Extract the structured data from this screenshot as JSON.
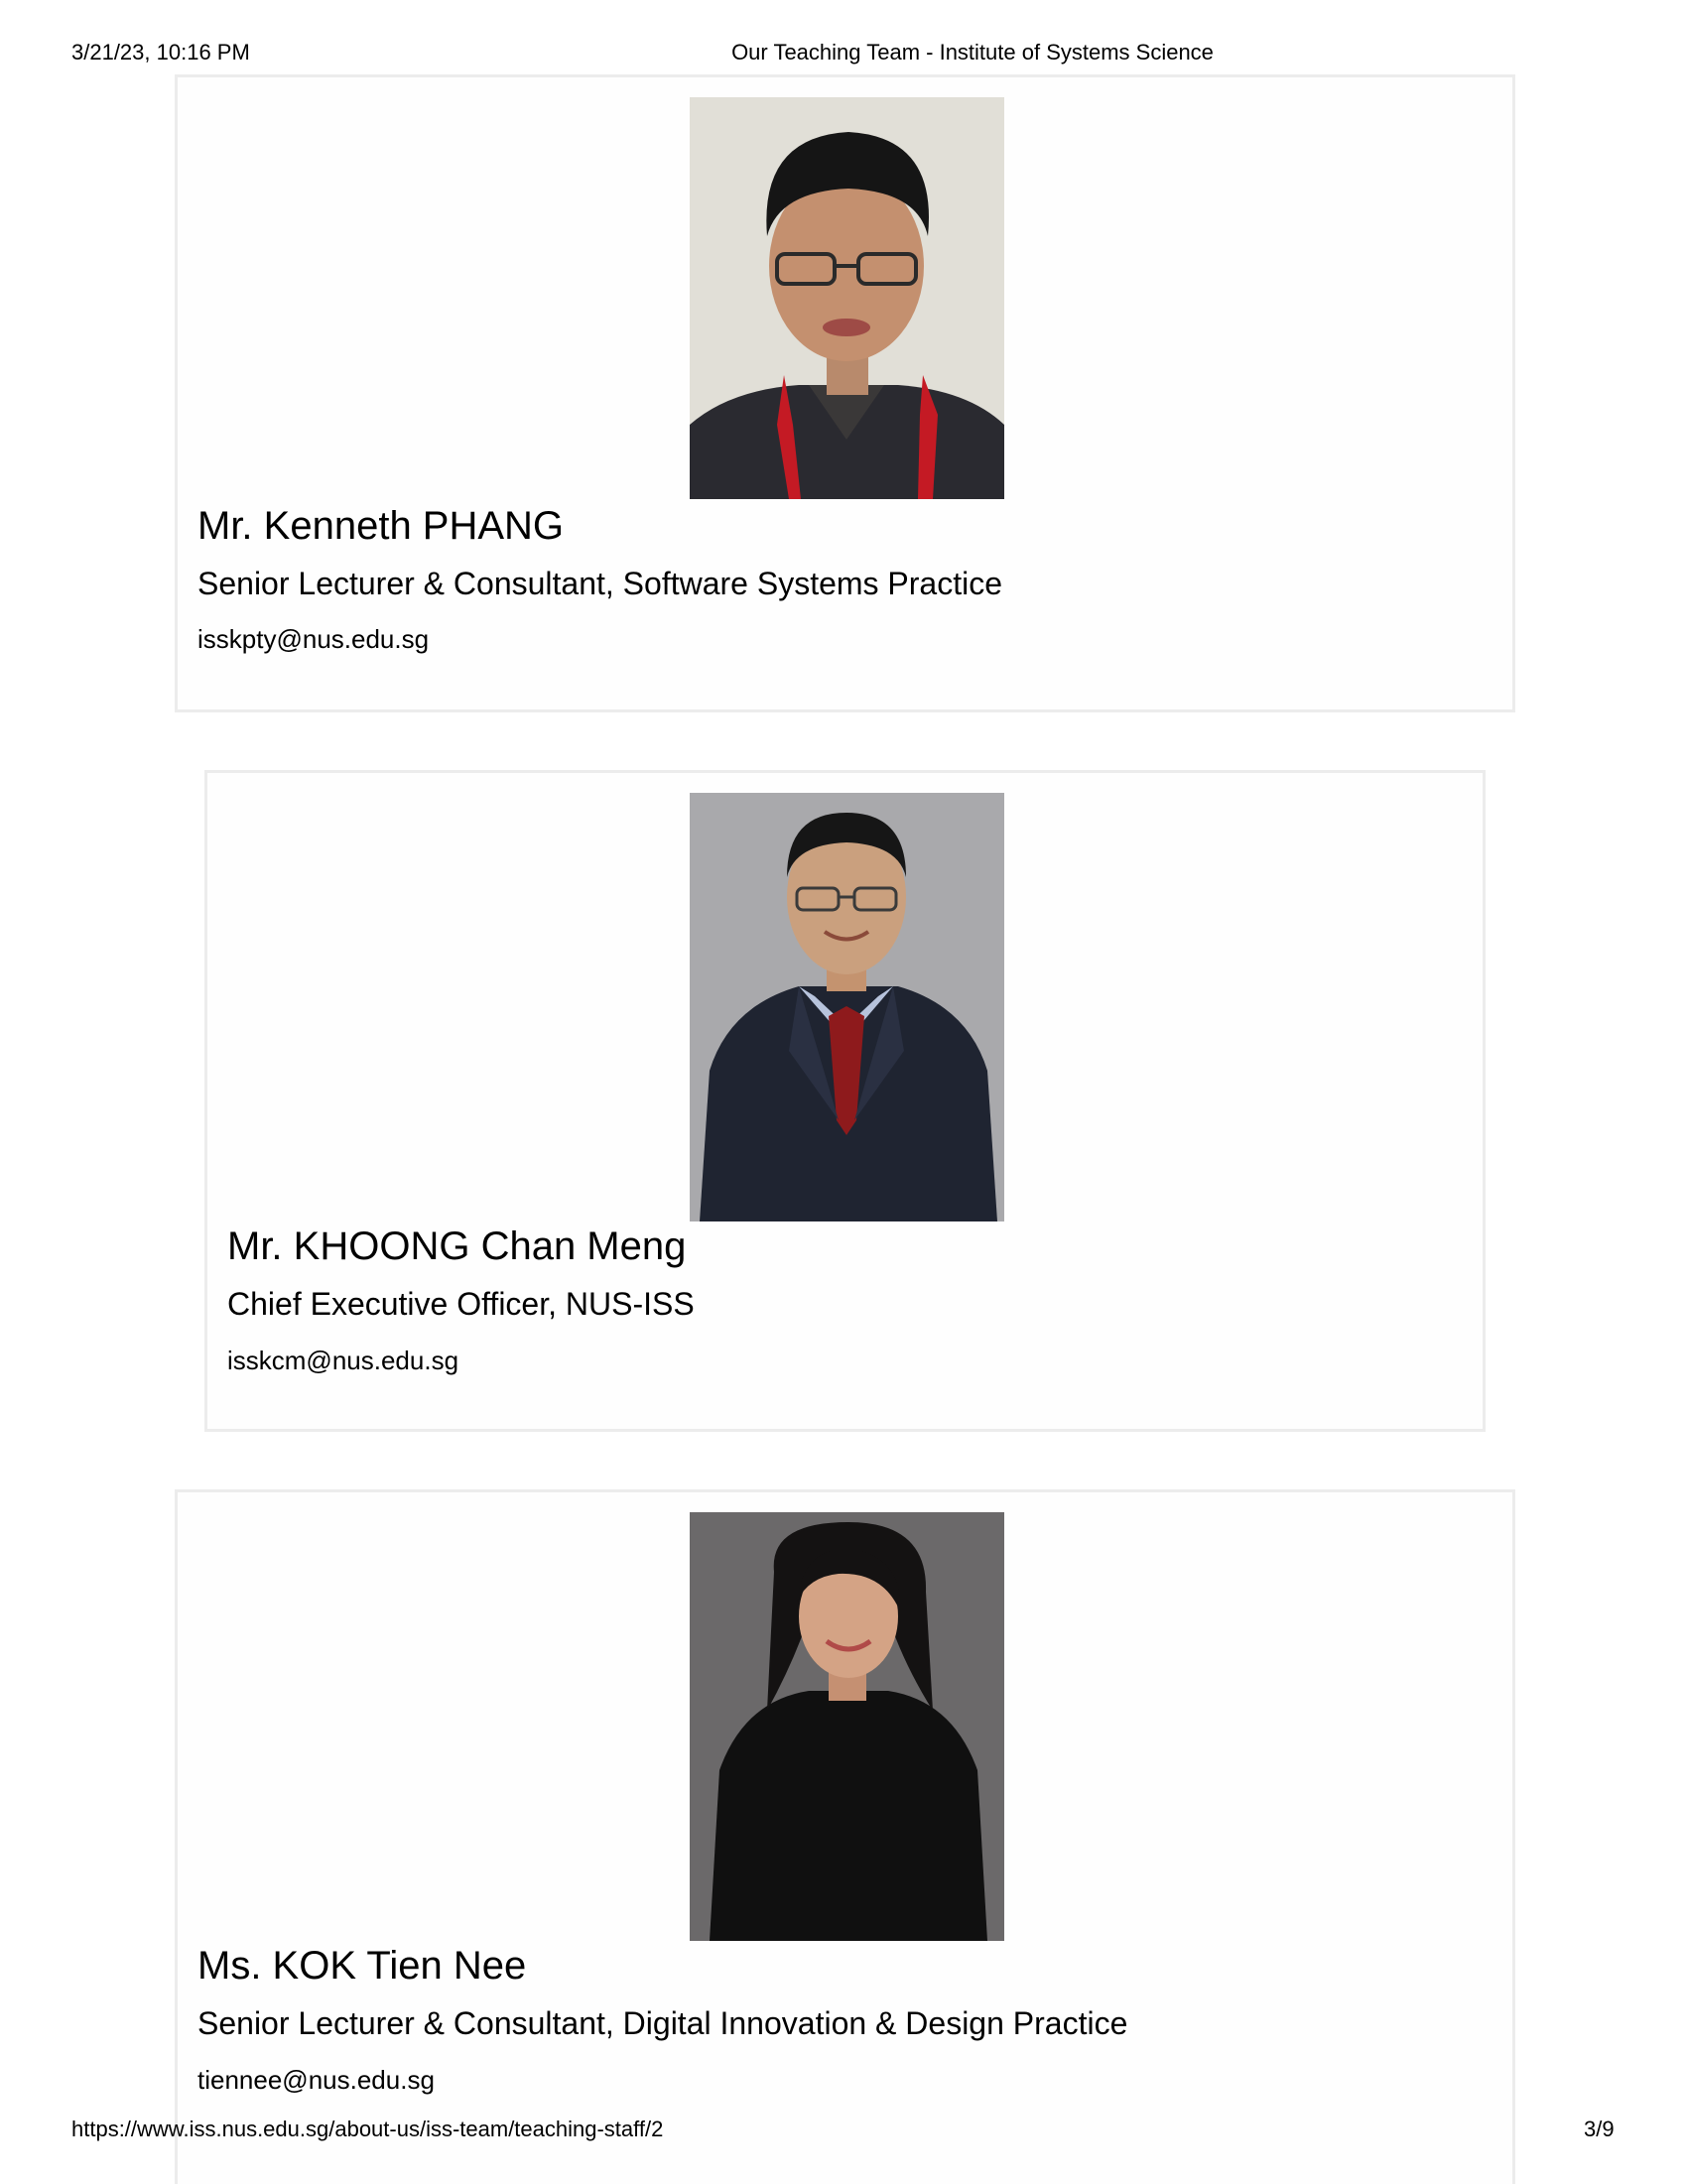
{
  "header": {
    "datetime": "3/21/23, 10:16 PM",
    "title": "Our Teaching Team - Institute of Systems Science"
  },
  "staff": [
    {
      "name": "Mr. Kenneth PHANG",
      "role": "Senior Lecturer & Consultant, Software Systems Practice",
      "email": "isskpty@nus.edu.sg"
    },
    {
      "name": "Mr. KHOONG Chan Meng",
      "role": "Chief Executive Officer, NUS-ISS",
      "email": "isskcm@nus.edu.sg"
    },
    {
      "name": "Ms. KOK Tien Nee",
      "role": "Senior Lecturer & Consultant, Digital Innovation & Design Practice",
      "email": "tiennee@nus.edu.sg"
    }
  ],
  "footer": {
    "url": "https://www.iss.nus.edu.sg/about-us/iss-team/teaching-staff/2",
    "page": "3/9"
  }
}
